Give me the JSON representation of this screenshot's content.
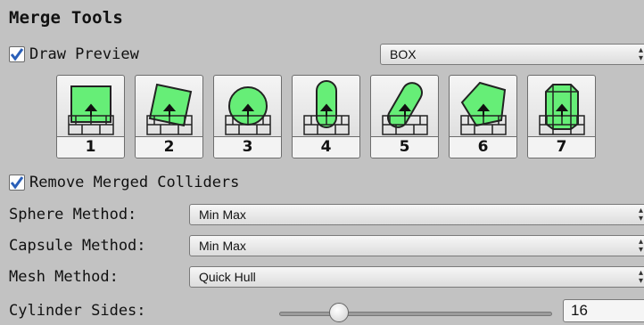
{
  "section_title": "Merge Tools",
  "draw_preview": {
    "label": "Draw Preview",
    "checked": true,
    "mode": "BOX"
  },
  "shape_buttons": [
    {
      "number": "1",
      "shape": "box"
    },
    {
      "number": "2",
      "shape": "rotated-box"
    },
    {
      "number": "3",
      "shape": "sphere"
    },
    {
      "number": "4",
      "shape": "capsule"
    },
    {
      "number": "5",
      "shape": "rotated-capsule"
    },
    {
      "number": "6",
      "shape": "convex-hull"
    },
    {
      "number": "7",
      "shape": "cylinder"
    }
  ],
  "remove_merged": {
    "label": "Remove Merged Colliders",
    "checked": true
  },
  "sphere_method": {
    "label": "Sphere Method:",
    "value": "Min Max"
  },
  "capsule_method": {
    "label": "Capsule Method:",
    "value": "Min Max"
  },
  "mesh_method": {
    "label": "Mesh Method:",
    "value": "Quick Hull"
  },
  "cylinder_sides": {
    "label": "Cylinder Sides:",
    "value": "16"
  },
  "colors": {
    "shape_fill": "#66ee77",
    "panel_bg": "#c2c2c2",
    "check_blue": "#2a5fb8"
  }
}
